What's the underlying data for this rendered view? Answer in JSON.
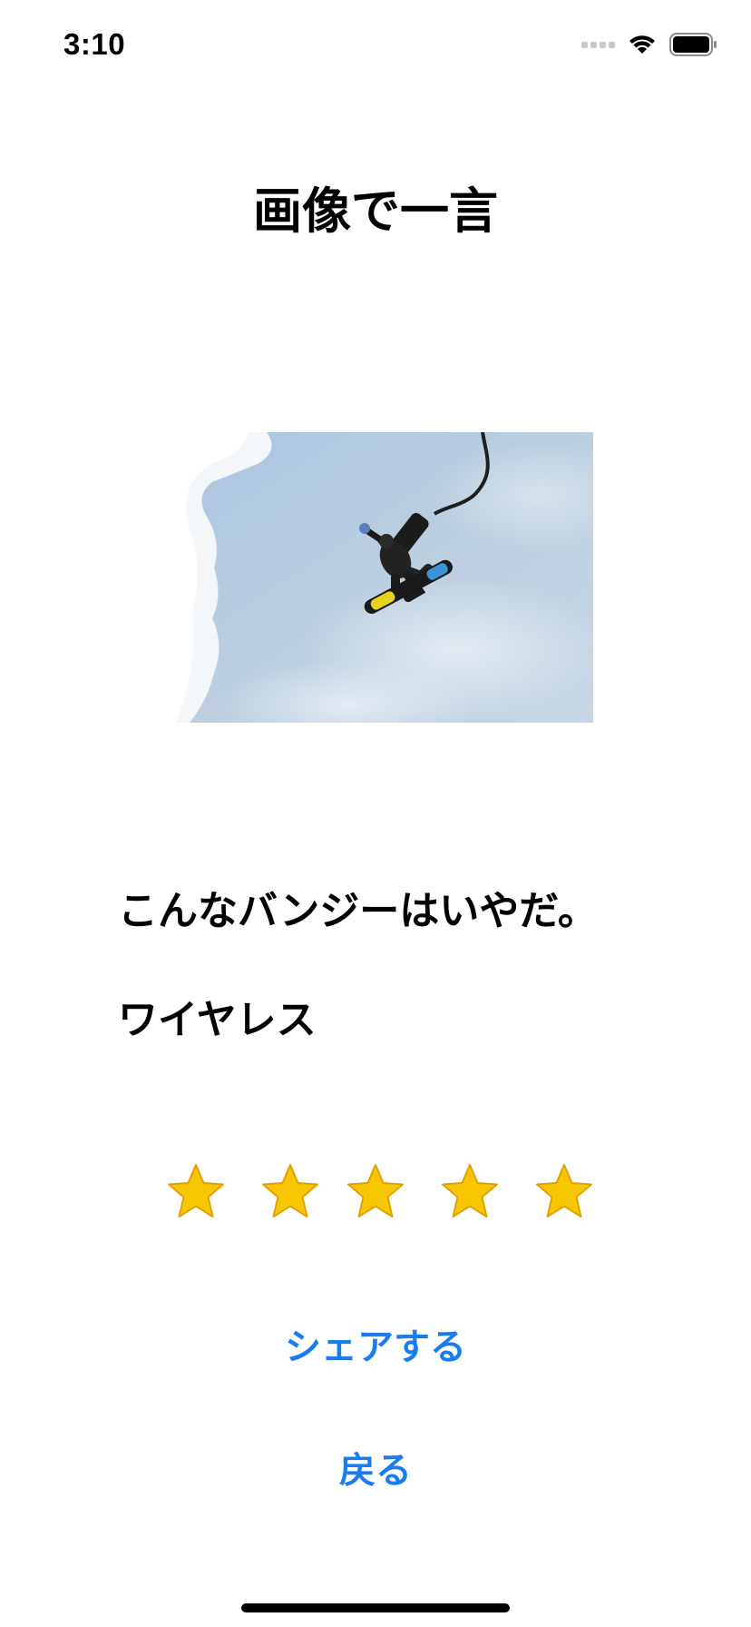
{
  "status_bar": {
    "time": "3:10",
    "icons": [
      "signal-icon",
      "wifi-icon",
      "battery-icon"
    ]
  },
  "title": "画像で一言",
  "photo": {
    "subject": "bungee-snowboarder-photo"
  },
  "caption": "こんなバンジーはいやだ。",
  "author": "ワイヤレス",
  "rating": {
    "value": 5,
    "max": 5,
    "star_color": "#f7c600"
  },
  "buttons": {
    "share_label": "シェアする",
    "back_label": "戻る"
  },
  "colors": {
    "accent": "#1a7cf0",
    "text": "#000000",
    "background": "#ffffff"
  }
}
